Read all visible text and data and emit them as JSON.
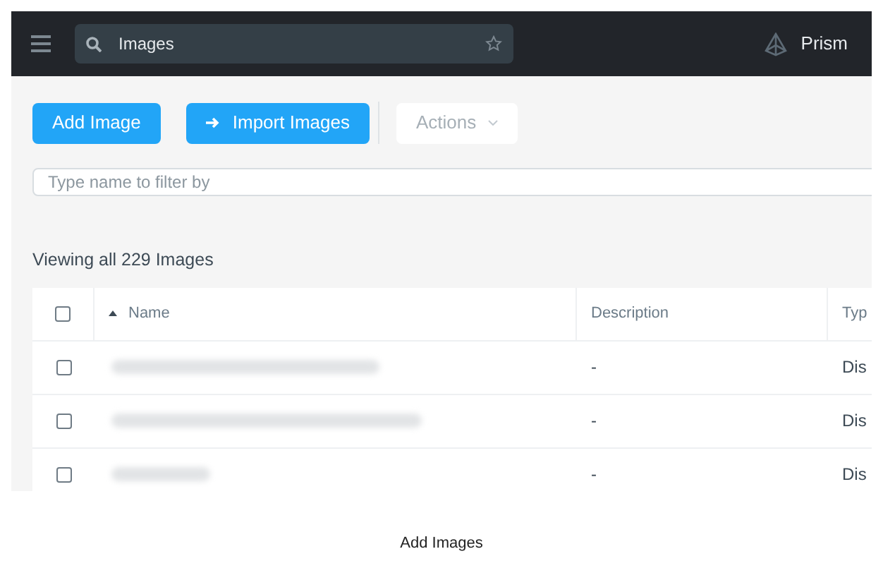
{
  "top_bar": {
    "search_value": "Images",
    "brand": "Prism"
  },
  "toolbar": {
    "buttons": [
      {
        "label": "Add Image",
        "kind": "primary"
      },
      {
        "label": "Import Images",
        "kind": "import"
      },
      {
        "label": "Actions",
        "kind": "dropdown"
      }
    ]
  },
  "filter": {
    "placeholder": "Type name to filter by"
  },
  "summary": "Viewing all 229 Images",
  "table": {
    "header_checked": false,
    "columns": [
      {
        "label": "Name",
        "sorted": true
      },
      {
        "label": "Description",
        "sorted": false
      },
      {
        "label": "Typ",
        "sorted": false
      }
    ],
    "rows": [
      {
        "checked": false,
        "name_blurred": true,
        "description": "-",
        "type": "Dis"
      },
      {
        "checked": false,
        "name_blurred": true,
        "description": "-",
        "type": "Dis"
      },
      {
        "checked": false,
        "name_blurred": true,
        "description": "-",
        "type": "Dis"
      }
    ]
  },
  "caption": "Add Images"
}
